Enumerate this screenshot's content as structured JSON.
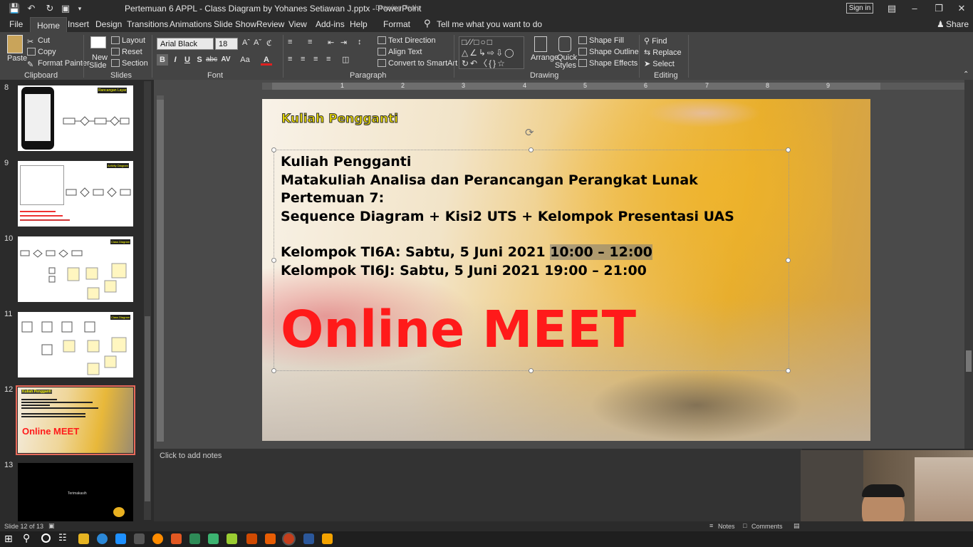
{
  "window": {
    "title": "Pertemuan 6 APPL - Class Diagram by Yohanes Setiawan J.pptx  -  PowerPoint",
    "contextual_label": "Drawing Tools",
    "sign_in": "Sign in"
  },
  "menu": {
    "tabs": [
      "File",
      "Home",
      "Insert",
      "Design",
      "Transitions",
      "Animations",
      "Slide Show",
      "Review",
      "View",
      "Add-ins",
      "Help",
      "Format"
    ],
    "active": "Home",
    "tell_me": "Tell me what you want to do",
    "share": "Share"
  },
  "ribbon": {
    "clipboard": {
      "paste": "Paste",
      "cut": "Cut",
      "copy": "Copy",
      "format_painter": "Format Painter",
      "label": "Clipboard"
    },
    "slides": {
      "new_slide": "New",
      "new_slide2": "Slide",
      "layout": "Layout",
      "reset": "Reset",
      "section": "Section",
      "label": "Slides"
    },
    "font": {
      "family": "Arial Black",
      "size": "18",
      "bold": "B",
      "italic": "I",
      "underline": "U",
      "shadow": "S",
      "strike": "abc",
      "spacing": "AV",
      "case": "Aa",
      "color": "A",
      "label": "Font"
    },
    "paragraph": {
      "text_direction": "Text Direction",
      "align_text": "Align Text",
      "smartart": "Convert to SmartArt",
      "label": "Paragraph"
    },
    "drawing": {
      "arrange": "Arrange",
      "quick_styles": "Quick",
      "quick_styles2": "Styles",
      "shape_fill": "Shape Fill",
      "shape_outline": "Shape Outline",
      "shape_effects": "Shape Effects",
      "label": "Drawing"
    },
    "editing": {
      "find": "Find",
      "replace": "Replace",
      "select": "Select",
      "label": "Editing"
    }
  },
  "thumbnails": {
    "numbers": [
      "8",
      "9",
      "10",
      "11",
      "12",
      "13"
    ],
    "t8_title": "Rancangan Layar",
    "t9_title": "Activity Diagram",
    "t10_title": "Class Diagram",
    "t11_title": "Class Diagram",
    "t12_title": "Kuliah Pengganti",
    "t12_meet": "Online MEET",
    "t13_text": "Terimakasih",
    "selected": "12"
  },
  "slide": {
    "header": "Kuliah Pengganti",
    "lines": [
      "Kuliah Pengganti",
      "Matakuliah Analisa dan Perancangan Perangkat Lunak",
      "Pertemuan 7:",
      "Sequence Diagram + Kisi2 UTS + Kelompok Presentasi UAS"
    ],
    "group_a_prefix": "Kelompok TI6A: Sabtu, 5 Juni 2021 ",
    "group_a_time": "10:00 – 12:00",
    "group_j": "Kelompok TI6J: Sabtu, 5 Juni 2021 19:00 – 21:00",
    "big_text": "Online MEET"
  },
  "ruler": {
    "marks": [
      "1",
      "2",
      "3",
      "4",
      "5",
      "6",
      "7",
      "8",
      "9"
    ]
  },
  "notes": {
    "placeholder": "Click to add notes"
  },
  "status": {
    "slide_count": "Slide 12 of 13",
    "notes": "Notes",
    "comments": "Comments"
  },
  "colors": {
    "header_text": "#e8d800",
    "meet_red": "#ff1a1a",
    "selected_outline": "#e86a5a"
  }
}
